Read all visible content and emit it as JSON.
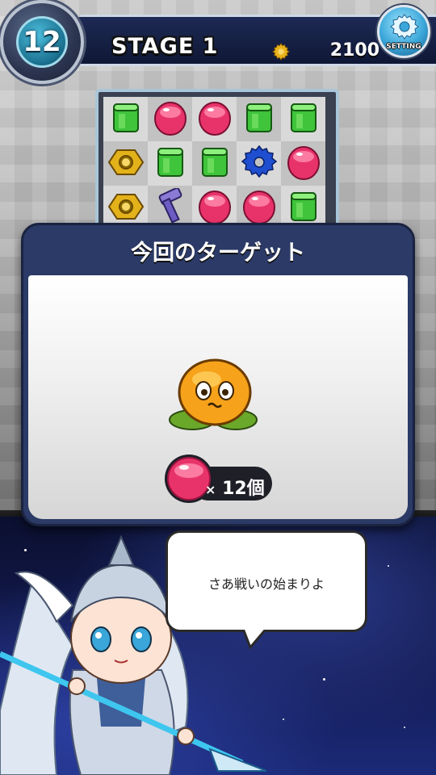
{
  "header": {
    "moves_remaining": "12",
    "stage_label": "STAGE 1",
    "score": "2100",
    "setting_label": "SETTING"
  },
  "board": {
    "rows": [
      [
        "green-block",
        "pink-gem",
        "pink-gem",
        "green-block",
        "green-block"
      ],
      [
        "gold-nut",
        "green-block",
        "green-block",
        "blue-gear",
        "pink-gem"
      ],
      [
        "gold-nut",
        "purple-bolt",
        "pink-gem",
        "pink-gem",
        "green-block"
      ]
    ]
  },
  "target_dialog": {
    "title": "今回のターゲット",
    "target_character": "orange-slime-monster",
    "goal_piece": "pink-gem",
    "goal_count": "12個"
  },
  "character_dialog": {
    "text": "さあ戦いの始まりよ",
    "character": "silver-armored-lancer-girl"
  },
  "colors": {
    "header_bar": "#1d2a55",
    "dialog_header": "#2b3a66",
    "accent_cyan": "#4fc3f7",
    "pink_gem": "#e8336a",
    "green_block": "#3fc43b",
    "blue_gear": "#1f4fd0",
    "gold_nut": "#e3b21a"
  }
}
